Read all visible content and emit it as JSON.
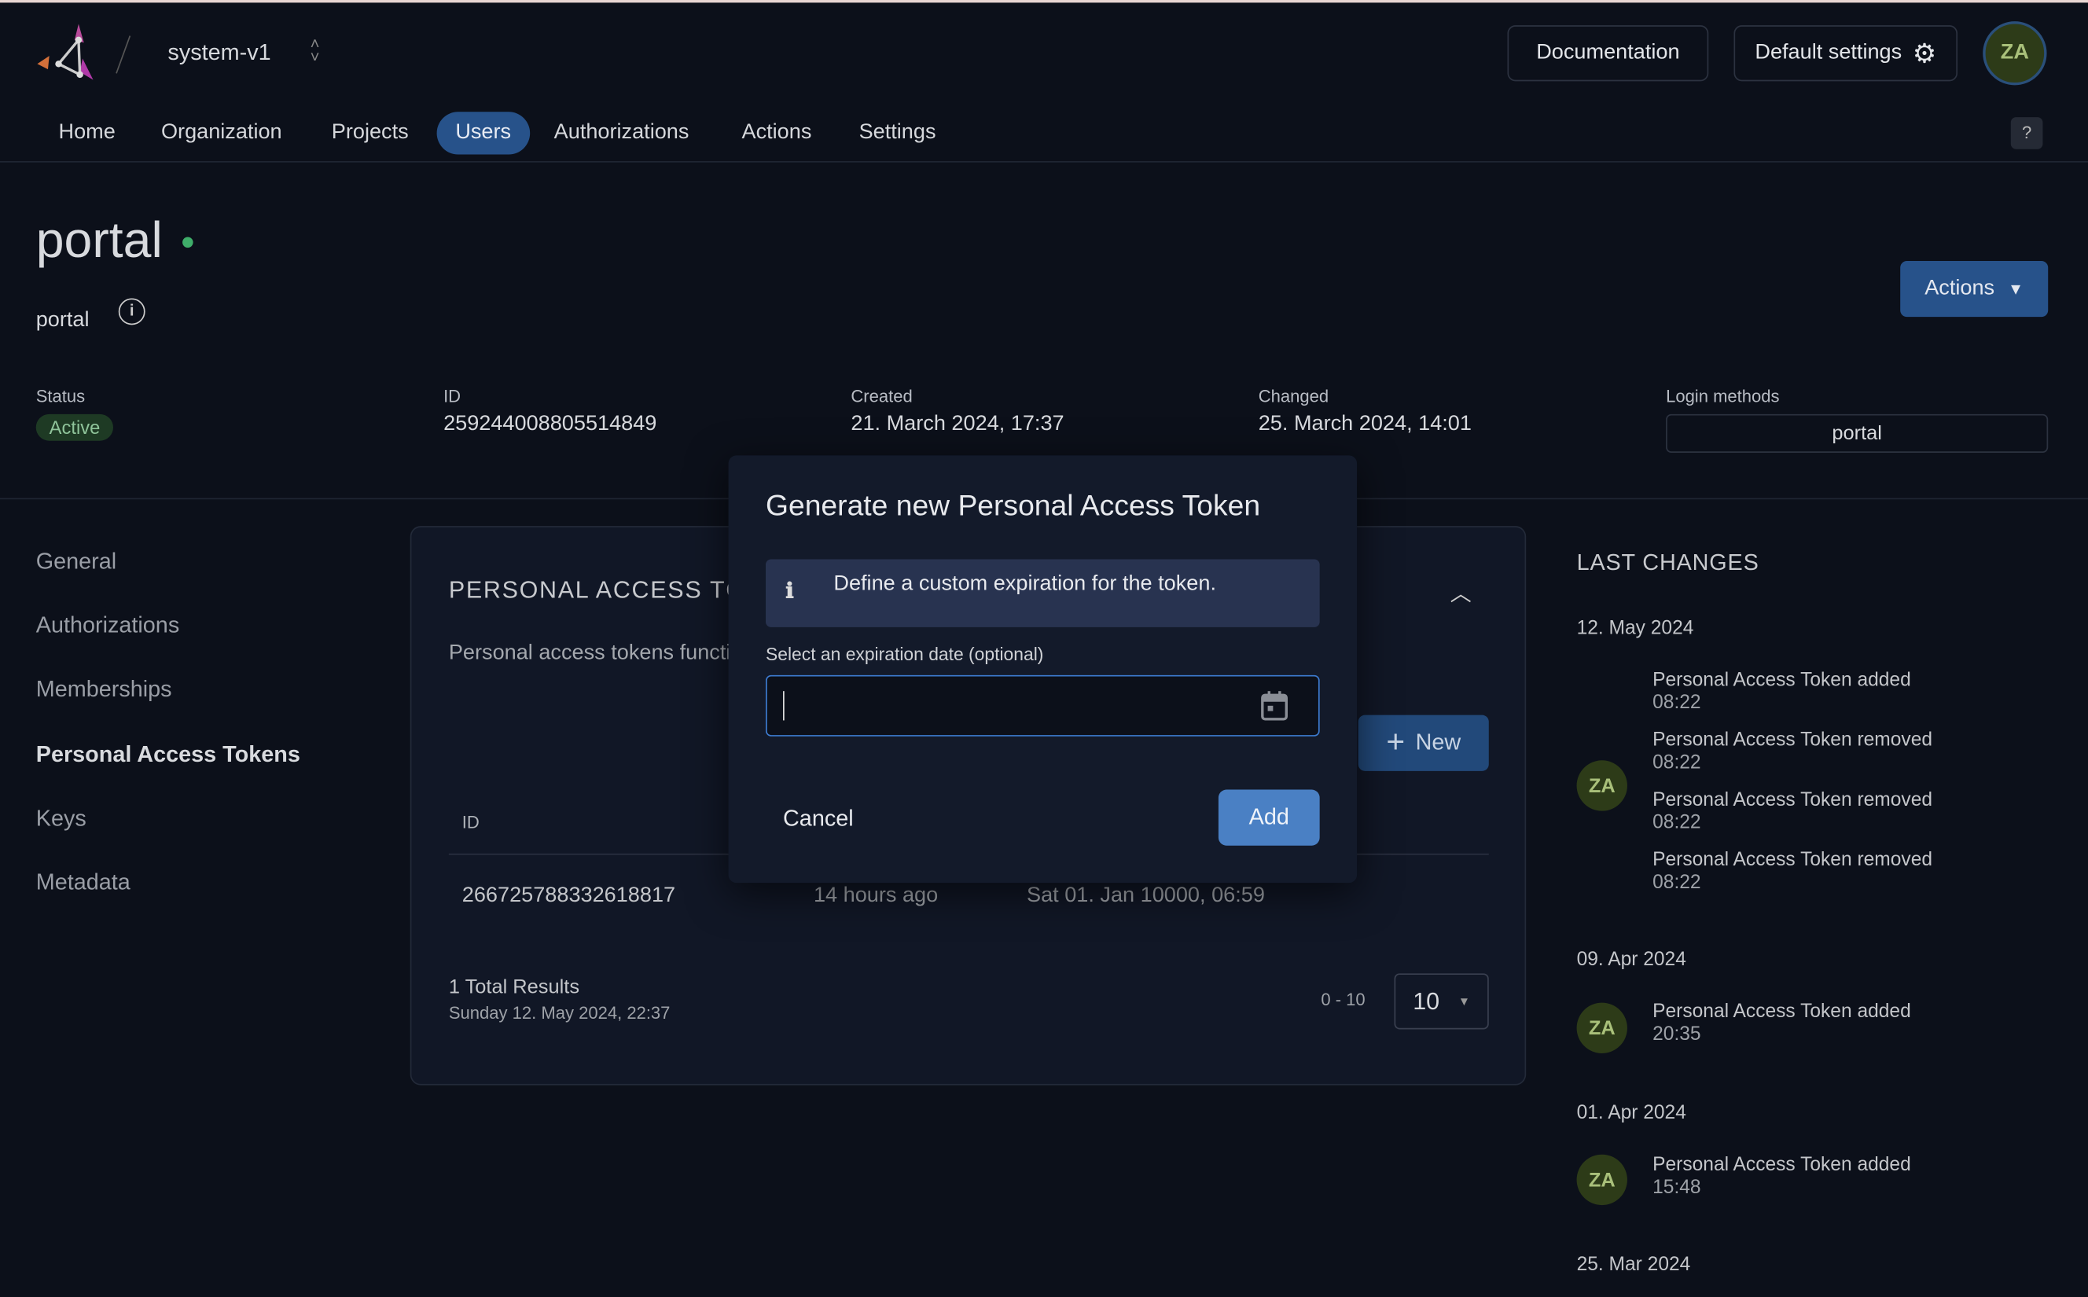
{
  "header": {
    "org": "system-v1",
    "documentation": "Documentation",
    "default_settings": "Default settings",
    "avatar": "ZA",
    "help": "?"
  },
  "nav": [
    {
      "label": "Home"
    },
    {
      "label": "Organization"
    },
    {
      "label": "Projects"
    },
    {
      "label": "Users",
      "active": true
    },
    {
      "label": "Authorizations"
    },
    {
      "label": "Actions"
    },
    {
      "label": "Settings"
    }
  ],
  "user": {
    "title": "portal",
    "subtitle": "portal",
    "actions": "Actions",
    "status_color": "#3fae6a"
  },
  "meta": {
    "status_label": "Status",
    "status": "Active",
    "id_label": "ID",
    "id": "259244008805514849",
    "created_label": "Created",
    "created": "21. March 2024, 17:37",
    "changed_label": "Changed",
    "changed": "25. March 2024, 14:01",
    "login_label": "Login methods",
    "login": "portal"
  },
  "sidebar": [
    {
      "label": "General"
    },
    {
      "label": "Authorizations"
    },
    {
      "label": "Memberships"
    },
    {
      "label": "Personal Access Tokens",
      "active": true
    },
    {
      "label": "Keys"
    },
    {
      "label": "Metadata"
    }
  ],
  "card": {
    "title": "PERSONAL ACCESS TC",
    "desc": "Personal access tokens functi",
    "new": "New",
    "col_id": "ID",
    "rows": [
      {
        "id": "266725788332618817",
        "created": "14 hours ago",
        "expires": "Sat 01. Jan 10000, 06:59"
      }
    ],
    "total": "1 Total Results",
    "timestamp": "Sunday 12. May 2024, 22:37",
    "range": "0 - 10",
    "page_size": "10"
  },
  "modal": {
    "title": "Generate new Personal Access Token",
    "info": "Define a custom expiration for the token.",
    "field_label": "Select an expiration date (optional)",
    "field_value": "",
    "cancel": "Cancel",
    "add": "Add"
  },
  "changes": {
    "title": "LAST CHANGES",
    "groups": [
      {
        "date": "12. May 2024",
        "items": [
          {
            "text": "Personal Access Token added",
            "time": "08:22"
          },
          {
            "text": "Personal Access Token removed",
            "time": "08:22"
          },
          {
            "text": "Personal Access Token removed",
            "time": "08:22"
          },
          {
            "text": "Personal Access Token removed",
            "time": "08:22"
          }
        ]
      },
      {
        "date": "09. Apr 2024",
        "items": [
          {
            "text": "Personal Access Token added",
            "time": "20:35"
          }
        ]
      },
      {
        "date": "01. Apr 2024",
        "items": [
          {
            "text": "Personal Access Token added",
            "time": "15:48"
          }
        ]
      },
      {
        "date": "25. Mar 2024",
        "items": []
      }
    ]
  }
}
